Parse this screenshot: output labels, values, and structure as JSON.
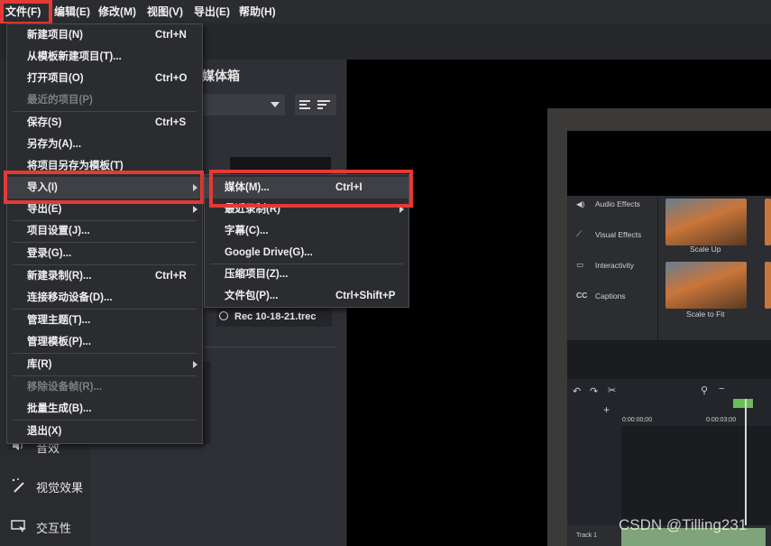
{
  "menubar": {
    "items": [
      "文件(F)",
      "编辑(E)",
      "修改(M)",
      "视图(V)",
      "导出(E)",
      "帮助(H)"
    ]
  },
  "media_bin": {
    "title": "媒体箱",
    "file_name": "Rec 10-18-21.trec"
  },
  "sidebar": {
    "items": [
      {
        "label": "音效",
        "icon": "speaker-icon"
      },
      {
        "label": "视觉效果",
        "icon": "wand-icon"
      },
      {
        "label": "交互性",
        "icon": "interactivity-icon"
      }
    ]
  },
  "file_menu": {
    "items": [
      {
        "label": "新建项目(N)",
        "shortcut": "Ctrl+N"
      },
      {
        "label": "从模板新建项目(T)..."
      },
      {
        "label": "打开项目(O)",
        "shortcut": "Ctrl+O"
      },
      {
        "label": "最近的项目(P)",
        "disabled": true
      },
      {
        "label": "保存(S)",
        "shortcut": "Ctrl+S"
      },
      {
        "label": "另存为(A)..."
      },
      {
        "label": "将项目另存为模板(T)"
      },
      {
        "label": "导入(I)",
        "submenu": true
      },
      {
        "label": "导出(E)",
        "submenu": true
      },
      {
        "label": "项目设置(J)..."
      },
      {
        "label": "登录(G)..."
      },
      {
        "label": "新建录制(R)...",
        "shortcut": "Ctrl+R"
      },
      {
        "label": "连接移动设备(D)..."
      },
      {
        "label": "管理主题(T)..."
      },
      {
        "label": "管理模板(P)..."
      },
      {
        "label": "库(R)",
        "submenu": true
      },
      {
        "label": "移除设备帧(R)...",
        "disabled": true
      },
      {
        "label": "批量生成(B)..."
      },
      {
        "label": "退出(X)"
      }
    ]
  },
  "import_submenu": {
    "items": [
      {
        "label": "媒体(M)...",
        "shortcut": "Ctrl+I"
      },
      {
        "label": "最近录制(R)",
        "submenu": true
      },
      {
        "label": "字幕(C)..."
      },
      {
        "label": "Google Drive(G)..."
      },
      {
        "label": "压缩项目(Z)..."
      },
      {
        "label": "文件包(P)...",
        "shortcut": "Ctrl+Shift+P"
      }
    ]
  },
  "preview": {
    "panel_items": [
      "Audio Effects",
      "Visual Effects",
      "Interactivity",
      "Captions"
    ],
    "thumb_labels": [
      "Scale Up",
      "Scale to Fit"
    ],
    "timeline_times": [
      "0:00:00;00",
      "0:00:03;00"
    ],
    "track_label": "Track 1"
  },
  "watermark": "CSDN @Tilling231",
  "colors": {
    "highlight": "#e53935",
    "accent_green": "#3b5d2a"
  }
}
